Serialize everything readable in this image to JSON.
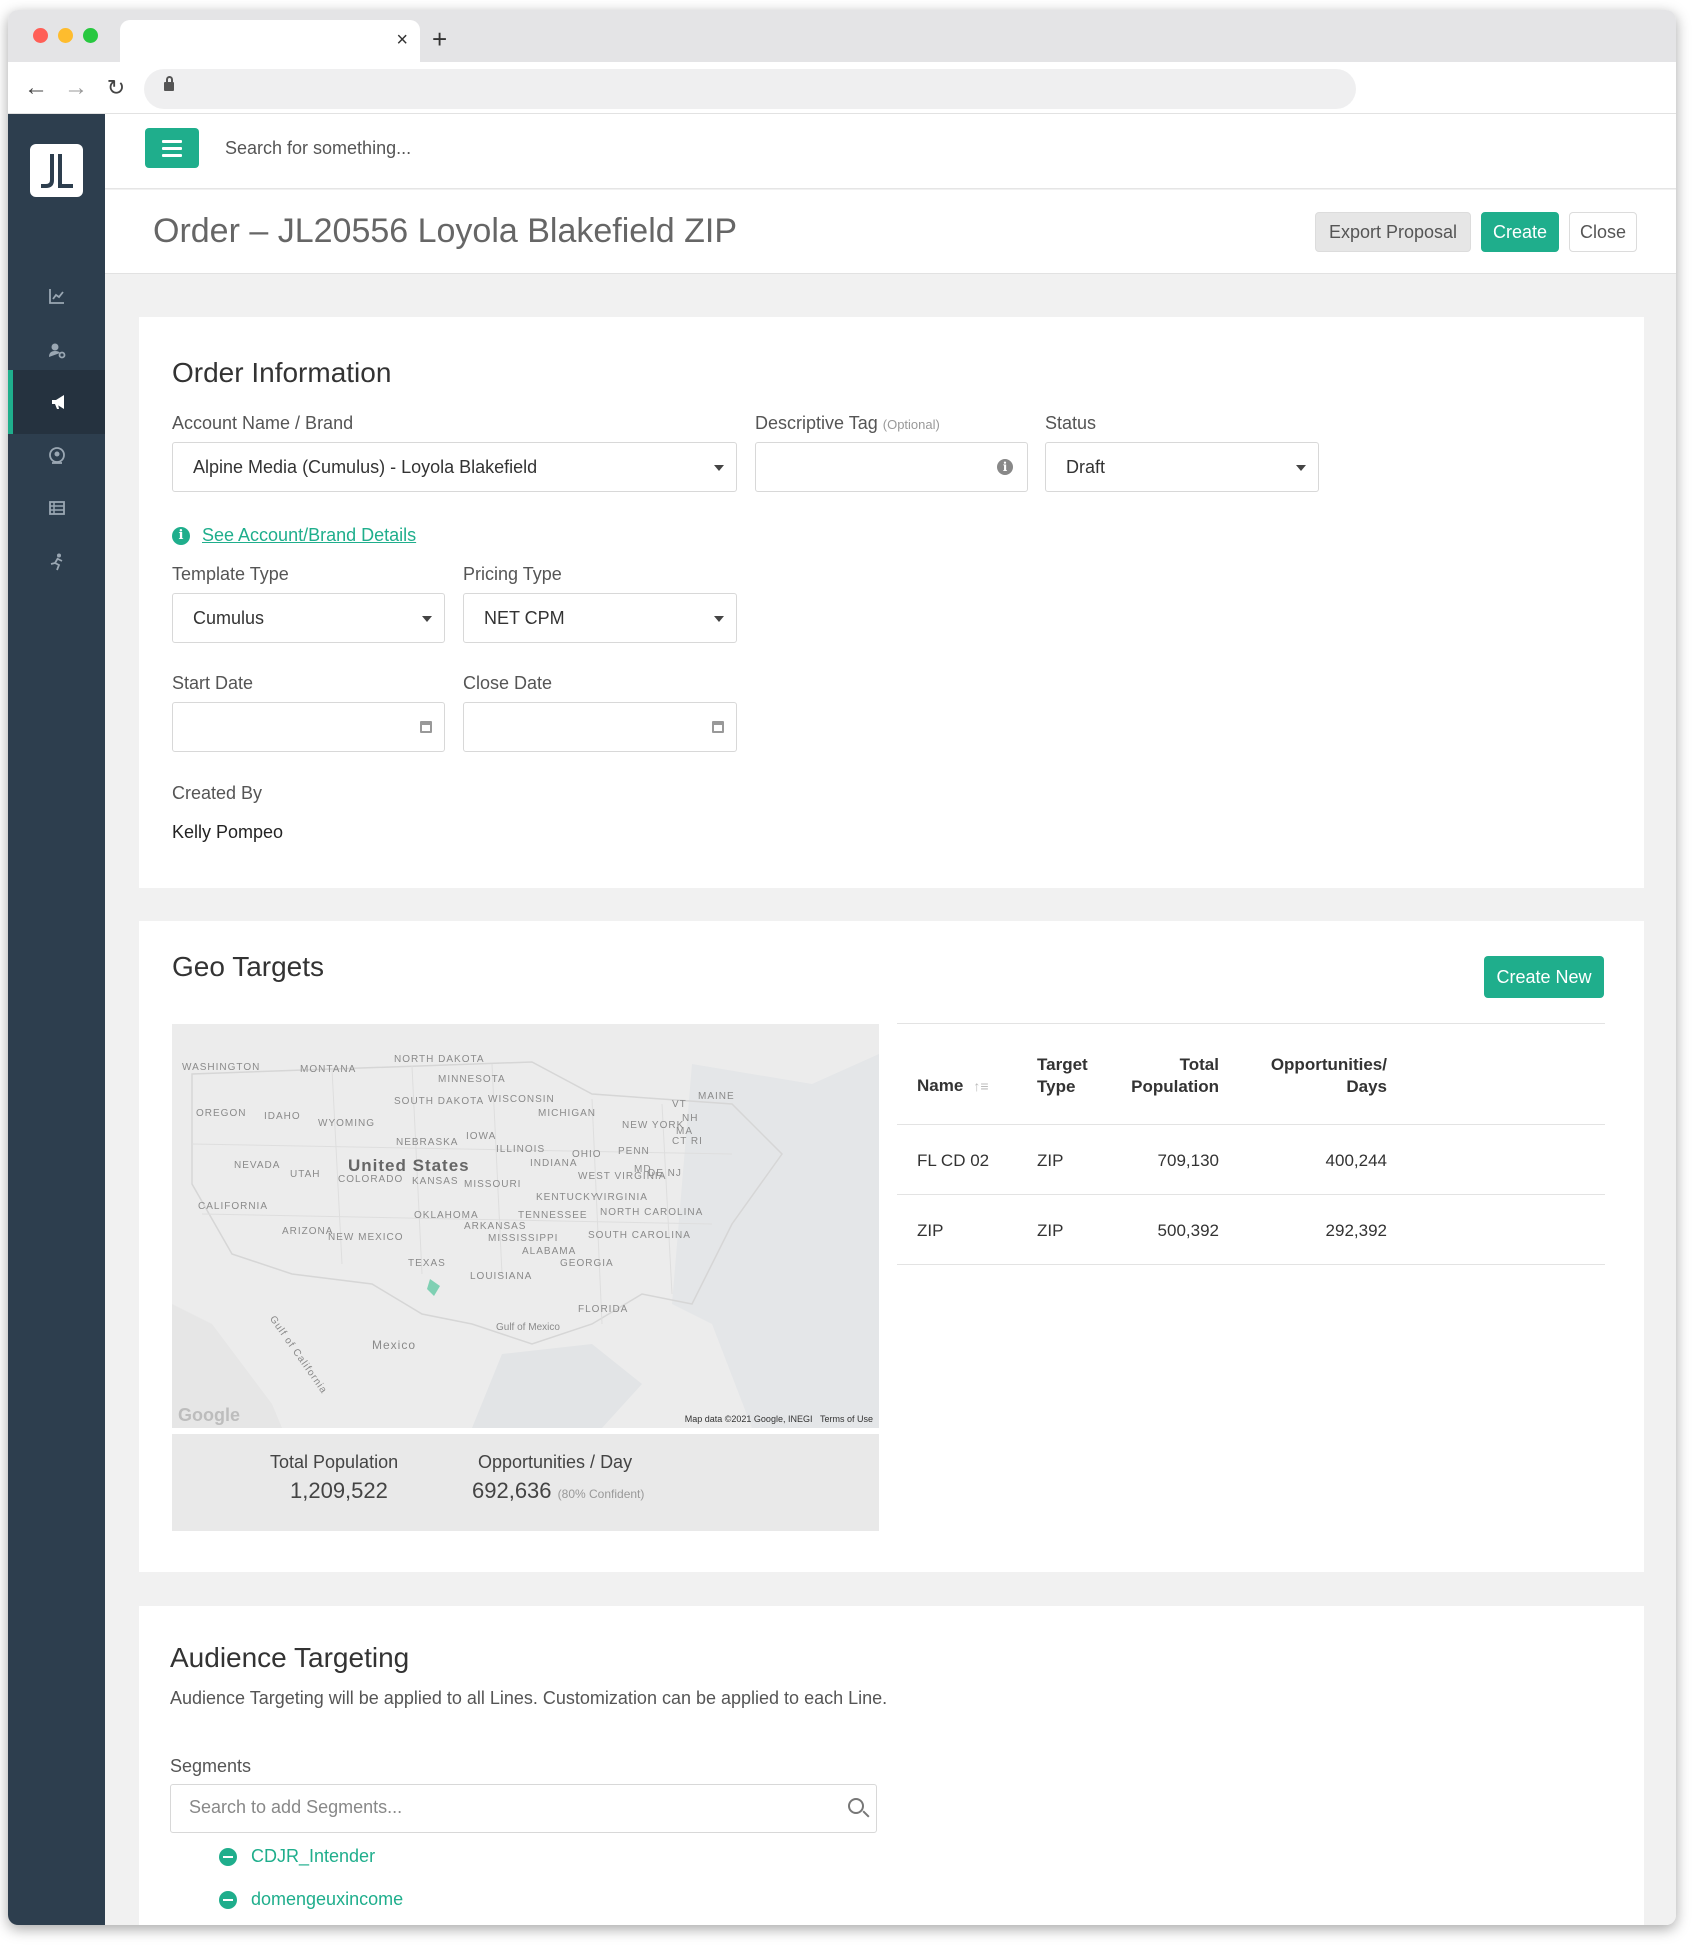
{
  "browser": {
    "tab_close": "×",
    "new_tab": "+",
    "back": "←",
    "forward": "→",
    "reload": "↻"
  },
  "topbar": {
    "search_placeholder": "Search for something..."
  },
  "sidebar": {
    "items": [
      {
        "icon": "chart-line-icon",
        "active": false
      },
      {
        "icon": "user-settings-icon",
        "active": false
      },
      {
        "icon": "megaphone-icon",
        "active": true
      },
      {
        "icon": "user-circle-icon",
        "active": false
      },
      {
        "icon": "table-list-icon",
        "active": false
      },
      {
        "icon": "running-person-icon",
        "active": false
      }
    ]
  },
  "page": {
    "title": "Order – JL20556 Loyola Blakefield ZIP",
    "export_label": "Export Proposal",
    "create_label": "Create",
    "close_label": "Close"
  },
  "order_info": {
    "title": "Order Information",
    "account_label": "Account Name / Brand",
    "account_value": "Alpine Media (Cumulus) - Loyola Blakefield",
    "tag_label": "Descriptive Tag",
    "tag_optional": "(Optional)",
    "tag_value": "",
    "status_label": "Status",
    "status_value": "Draft",
    "details_link": "See Account/Brand Details",
    "template_label": "Template Type",
    "template_value": "Cumulus",
    "pricing_label": "Pricing Type",
    "pricing_value": "NET CPM",
    "start_label": "Start Date",
    "start_value": "",
    "close_date_label": "Close Date",
    "close_date_value": "",
    "created_by_label": "Created By",
    "created_by_value": "Kelly Pompeo"
  },
  "geo": {
    "title": "Geo Targets",
    "create_new_label": "Create New",
    "map": {
      "country": "United States",
      "states": [
        "WASHINGTON",
        "MONTANA",
        "NORTH DAKOTA",
        "MINNESOTA",
        "OREGON",
        "IDAHO",
        "WYOMING",
        "SOUTH DAKOTA",
        "WISCONSIN",
        "MICHIGAN",
        "MAINE",
        "VT",
        "NH",
        "NEW YORK",
        "MA",
        "CT RI",
        "NEBRASKA",
        "IOWA",
        "ILLINOIS",
        "INDIANA",
        "OHIO",
        "PENN",
        "NEVADA",
        "UTAH",
        "COLORADO",
        "KANSAS",
        "MISSOURI",
        "WEST VIRGINIA",
        "MD",
        "DE NJ",
        "CALIFORNIA",
        "KENTUCKY",
        "VIRGINIA",
        "OKLAHOMA",
        "TENNESSEE",
        "NORTH CAROLINA",
        "ARIZONA",
        "NEW MEXICO",
        "ARKANSAS",
        "MISSISSIPPI",
        "SOUTH CAROLINA",
        "ALABAMA",
        "TEXAS",
        "GEORGIA",
        "LOUISIANA",
        "FLORIDA",
        "Gulf of California",
        "Mexico",
        "Gulf of Mexico"
      ],
      "google": "Google",
      "credit": "Map data ©2021 Google, INEGI",
      "terms": "Terms of Use"
    },
    "summary": {
      "pop_label": "Total Population",
      "pop_value": "1,209,522",
      "opp_label": "Opportunities / Day",
      "opp_value": "692,636",
      "opp_note": "(80% Confident)"
    },
    "table": {
      "headers": {
        "name": "Name",
        "target_type_1": "Target",
        "target_type_2": "Type",
        "total_pop_1": "Total",
        "total_pop_2": "Population",
        "opp_1": "Opportunities/",
        "opp_2": "Days"
      },
      "rows": [
        {
          "name": "FL CD 02",
          "type": "ZIP",
          "population": "709,130",
          "opportunities": "400,244"
        },
        {
          "name": "ZIP",
          "type": "ZIP",
          "population": "500,392",
          "opportunities": "292,392"
        }
      ]
    }
  },
  "audience": {
    "title": "Audience Targeting",
    "description": "Audience Targeting will be applied to all Lines. Customization can be applied to each Line.",
    "segments_label": "Segments",
    "segments_placeholder": "Search to add Segments...",
    "segments": [
      "CDJR_Intender",
      "domengeuxincome"
    ]
  },
  "colors": {
    "accent": "#1fae8c",
    "sidebar": "#2d3e4e"
  }
}
